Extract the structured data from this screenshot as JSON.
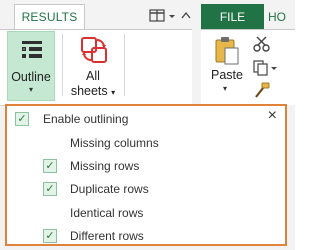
{
  "tabs": {
    "results": "RESULTS",
    "file": "FILE",
    "home": "HO"
  },
  "ribbon": {
    "outline_label": "Outline",
    "all_sheets_line1": "All",
    "all_sheets_line2": "sheets",
    "dropdown_arrow": "▾",
    "paste_label": "Paste"
  },
  "dropdown": {
    "close": "×",
    "enable_outlining": {
      "label": "Enable outlining",
      "checked": true
    },
    "items": [
      {
        "label": "Missing columns",
        "checked": false
      },
      {
        "label": "Missing rows",
        "checked": true
      },
      {
        "label": "Duplicate rows",
        "checked": true
      },
      {
        "label": "Identical rows",
        "checked": false
      },
      {
        "label": "Different rows",
        "checked": true
      }
    ],
    "check_mark": "✓"
  },
  "colors": {
    "accent_green": "#217346",
    "highlight_orange": "#e0823c",
    "outline_bg": "#c5e8d2",
    "all_sheets_red": "#d9312f"
  }
}
